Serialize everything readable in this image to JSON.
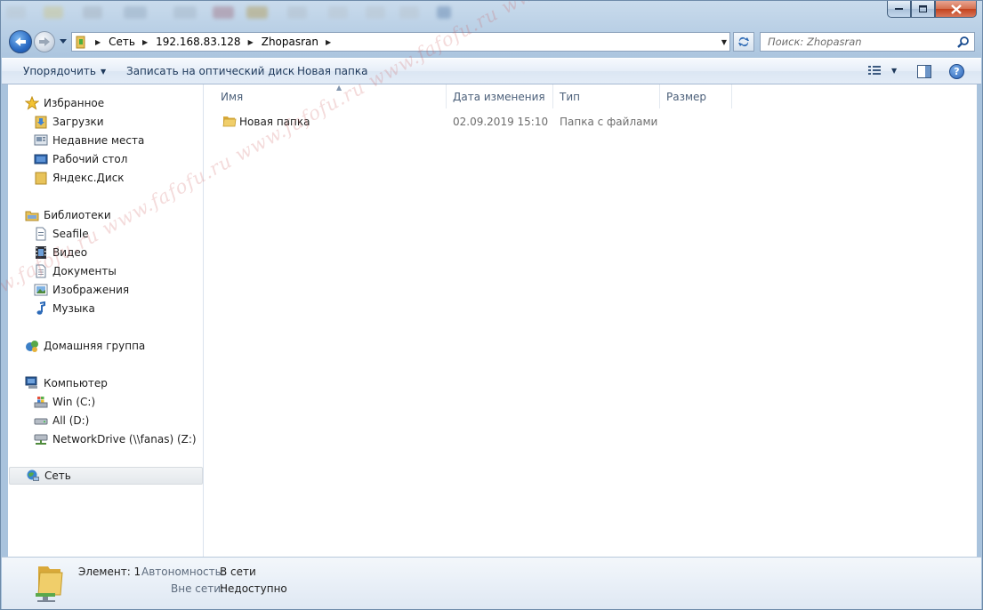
{
  "window": {
    "controls": {
      "minimize": "minimize",
      "maximize": "maximize",
      "close": "close"
    }
  },
  "address": {
    "crumbs": [
      "Сеть",
      "192.168.83.128",
      "Zhopasran"
    ]
  },
  "search": {
    "placeholder": "Поиск: Zhopasran"
  },
  "toolbar": {
    "organize": "Упорядочить",
    "burn": "Записать на оптический диск",
    "new_folder": "Новая папка"
  },
  "nav": {
    "favorites": {
      "label": "Избранное",
      "items": [
        "Загрузки",
        "Недавние места",
        "Рабочий стол",
        "Яндекс.Диск"
      ]
    },
    "libraries": {
      "label": "Библиотеки",
      "items": [
        "Seafile",
        "Видео",
        "Документы",
        "Изображения",
        "Музыка"
      ]
    },
    "homegroup": {
      "label": "Домашняя группа"
    },
    "computer": {
      "label": "Компьютер",
      "items": [
        "Win (C:)",
        "All (D:)",
        "NetworkDrive (\\\\fanas) (Z:)"
      ]
    },
    "network": {
      "label": "Сеть"
    }
  },
  "columns": [
    "Имя",
    "Дата изменения",
    "Тип",
    "Размер"
  ],
  "files": [
    {
      "name": "Новая папка",
      "date": "02.09.2019 15:10",
      "type": "Папка с файлами",
      "size": ""
    }
  ],
  "status": {
    "count_label": "Элемент: 1",
    "offline_label": "Автономность:",
    "offline_value": "В сети",
    "availability_label": "Вне сети:",
    "availability_value": "Недоступно"
  },
  "watermark": "www.fafofu.ru www.fafofu.ru www.fafofu.ru www.fafofu.ru www.fafofu.ru",
  "colors": {
    "accent": "#1e395b",
    "selection": "#e4e8ec",
    "folder": "#e8c35a"
  }
}
